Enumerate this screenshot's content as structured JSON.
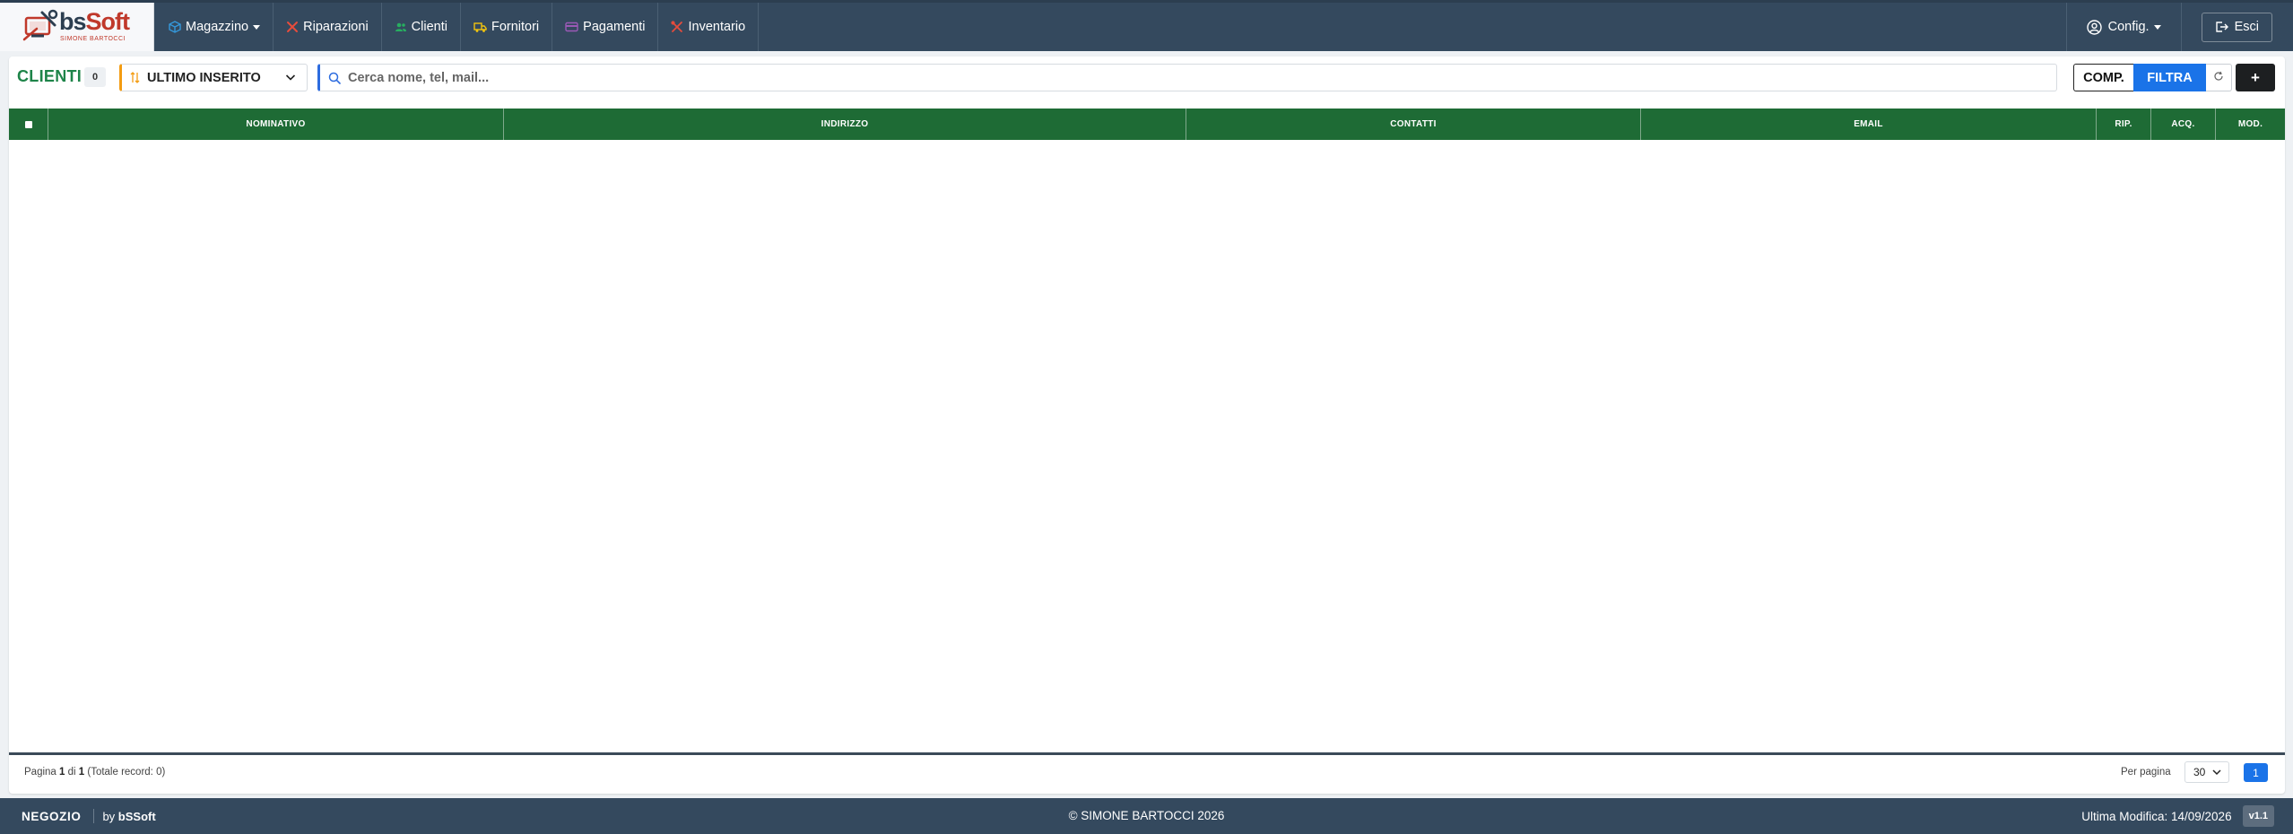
{
  "app": {
    "brand_name_part1": "bs",
    "brand_name_part2": "Soft",
    "brand_subtitle": "SIMONE BARTOCCI"
  },
  "nav": {
    "items": [
      {
        "label": "Magazzino",
        "icon": "cube-icon",
        "color": "#3498db",
        "dropdown": true
      },
      {
        "label": "Riparazioni",
        "icon": "wrench-cross-icon",
        "color": "#e74c3c"
      },
      {
        "label": "Clienti",
        "icon": "users-icon",
        "color": "#27ae60"
      },
      {
        "label": "Fornitori",
        "icon": "truck-icon",
        "color": "#f1c40f"
      },
      {
        "label": "Pagamenti",
        "icon": "card-icon",
        "color": "#9b59b6"
      },
      {
        "label": "Inventario",
        "icon": "tools-icon",
        "color": "#e74c3c"
      }
    ],
    "config_label": "Config.",
    "logout_label": "Esci"
  },
  "toolbar": {
    "title": "CLIENTI",
    "count": "0",
    "sort_label": "ULTIMO INSERITO",
    "search_placeholder": "Cerca nome, tel, mail...",
    "comp_label": "COMP.",
    "filter_label": "FILTRA",
    "add_label": "+"
  },
  "table": {
    "columns": [
      "NOMINATIVO",
      "INDIRIZZO",
      "CONTATTI",
      "EMAIL",
      "RIP.",
      "ACQ.",
      "MOD."
    ],
    "rows": [],
    "header_color": "#1e6b35"
  },
  "pagination": {
    "prefix": "Pagina ",
    "current": "1",
    "middle": " di ",
    "total": "1",
    "records": " (Totale record: 0)",
    "per_page_label": "Per pagina",
    "per_page_value": "30",
    "page_button": "1"
  },
  "footer": {
    "left_label": "NEGOZIO",
    "by_prefix": "by ",
    "by_brand": "bSSoft",
    "copyright": "© SIMONE BARTOCCI 2026",
    "last_modified": "Ultima Modifica: 14/09/2026",
    "version": "v1.1"
  }
}
